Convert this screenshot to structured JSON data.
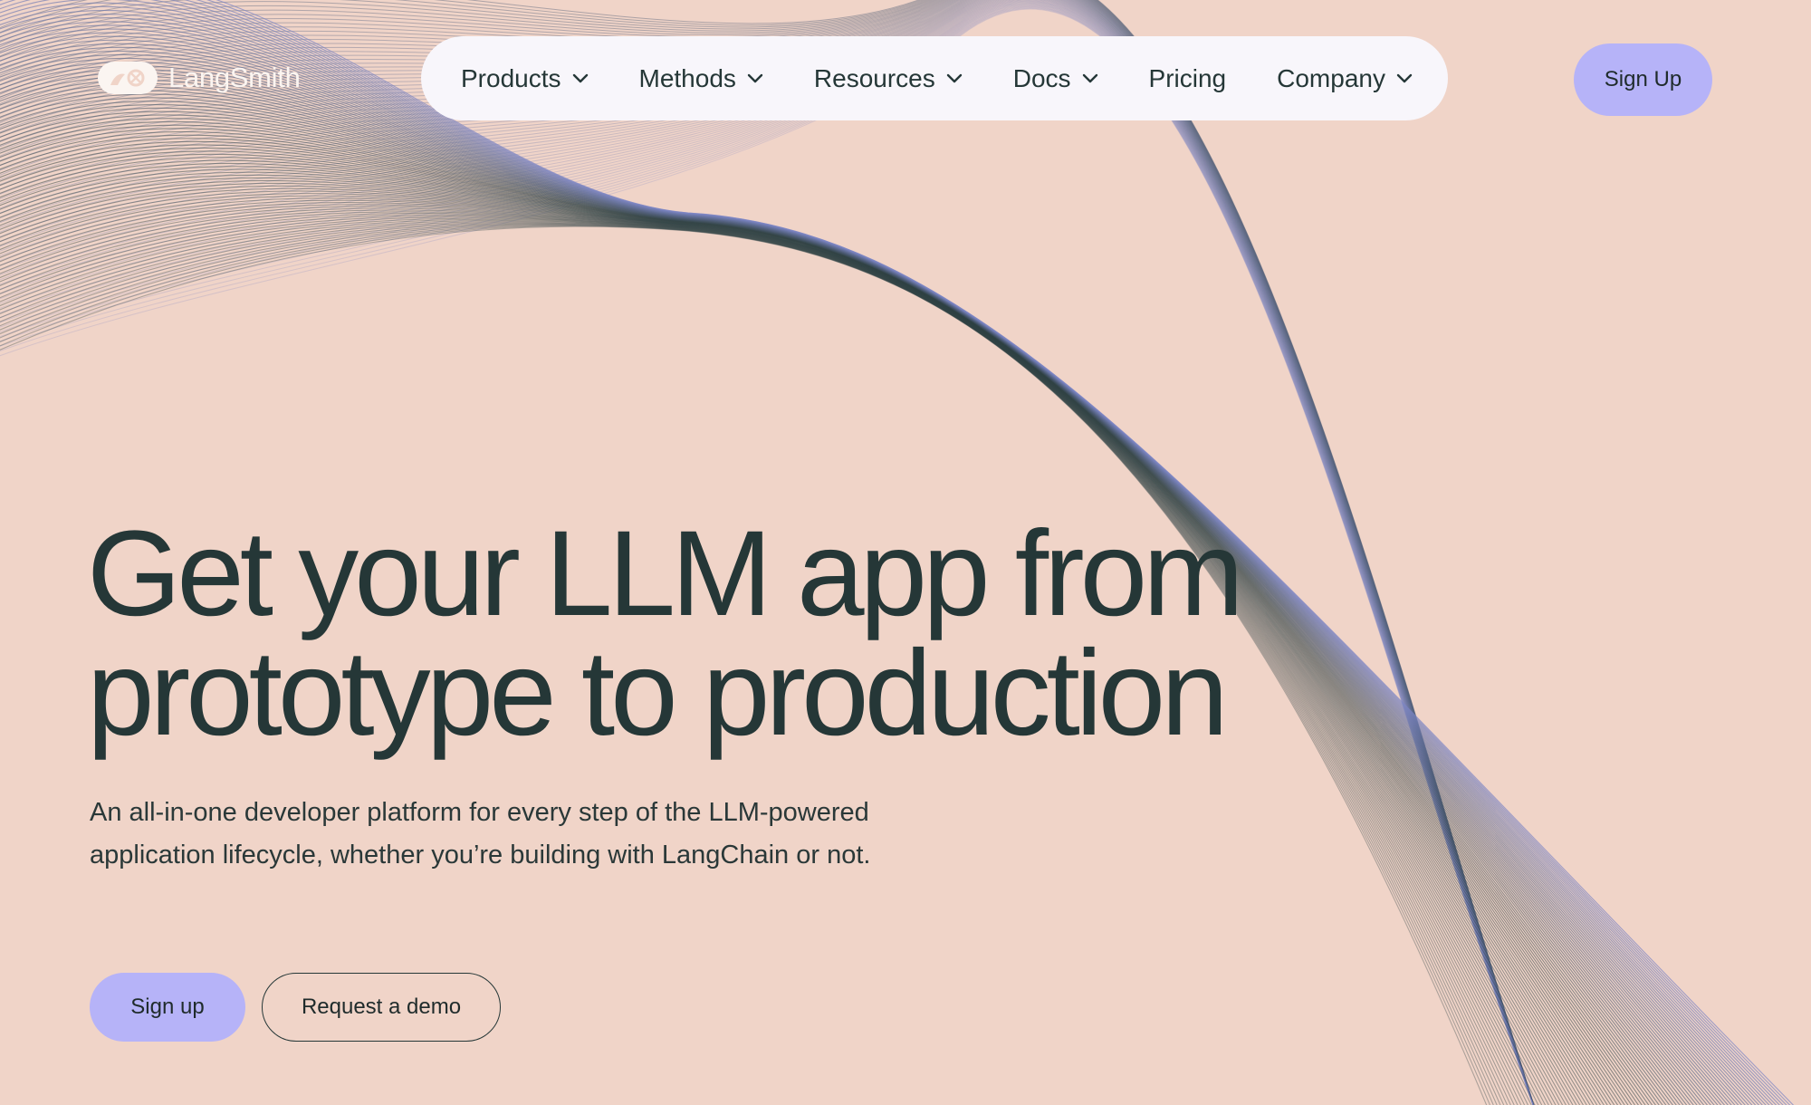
{
  "brand": {
    "name": "LangSmith",
    "logo_icon": "langchain-parrot-link-icon"
  },
  "nav": {
    "items": [
      {
        "label": "Products",
        "dropdown": true
      },
      {
        "label": "Methods",
        "dropdown": true
      },
      {
        "label": "Resources",
        "dropdown": true
      },
      {
        "label": "Docs",
        "dropdown": true
      },
      {
        "label": "Pricing",
        "dropdown": false
      },
      {
        "label": "Company",
        "dropdown": true
      }
    ],
    "signup_label": "Sign Up"
  },
  "hero": {
    "headline_line1": "Get your LLM app from",
    "headline_line2": "prototype to production",
    "subhead_line1": "An all-in-one developer platform for every step of the LLM-powered",
    "subhead_line2": "application lifecycle, whether you’re building with LangChain or not.",
    "primary_cta": "Sign up",
    "secondary_cta": "Request a demo"
  },
  "colors": {
    "background": "#f0d4c8",
    "accent": "#b6b3f8",
    "text": "#253737",
    "nav_bg": "#f8f6fb",
    "wave_dark": "#2f4244",
    "wave_blue": "#8f96e4"
  }
}
